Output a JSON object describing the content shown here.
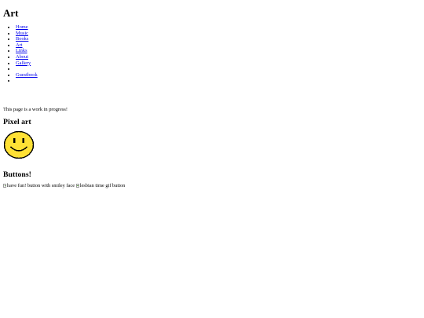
{
  "page": {
    "title": "Art"
  },
  "nav": {
    "items": [
      {
        "label": "Home"
      },
      {
        "label": "Music"
      },
      {
        "label": "Books"
      },
      {
        "label": "Art"
      },
      {
        "label": "Links"
      },
      {
        "label": "About"
      },
      {
        "label": "Gallery"
      },
      {
        "label": ""
      },
      {
        "label": "Guestbook"
      },
      {
        "label": ""
      }
    ]
  },
  "status": {
    "text": "This page is a work in progress!"
  },
  "sections": {
    "pixel_art": {
      "heading": "Pixel art",
      "image_icon": "smiley-face-icon",
      "colors": {
        "face": "#ffe135",
        "outline": "#000000"
      }
    },
    "buttons": {
      "heading": "Buttons!",
      "items": [
        {
          "alt": "have fun! button with smiley face"
        },
        {
          "alt": "lesbian time gif button"
        }
      ]
    }
  },
  "colors": {
    "link": "#0000ee",
    "text": "#000000",
    "background": "#ffffff"
  }
}
